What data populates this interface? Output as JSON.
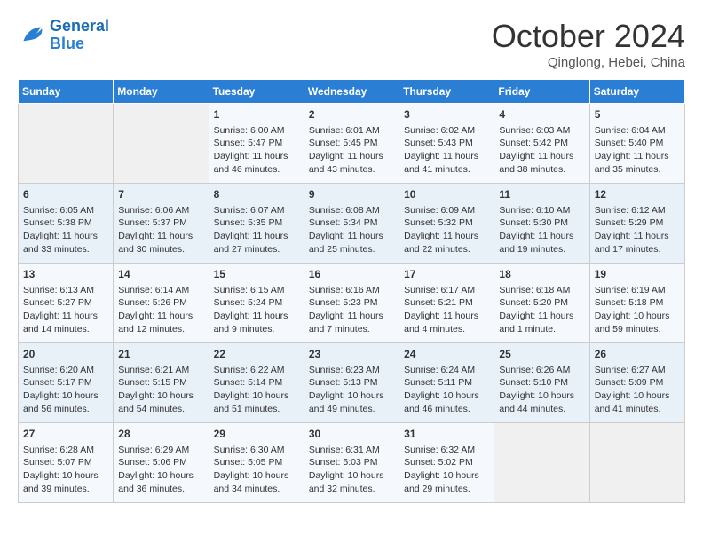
{
  "header": {
    "logo_line1": "General",
    "logo_line2": "Blue",
    "month": "October 2024",
    "location": "Qinglong, Hebei, China"
  },
  "days_of_week": [
    "Sunday",
    "Monday",
    "Tuesday",
    "Wednesday",
    "Thursday",
    "Friday",
    "Saturday"
  ],
  "weeks": [
    [
      {
        "day": "",
        "data": ""
      },
      {
        "day": "",
        "data": ""
      },
      {
        "day": "1",
        "data": "Sunrise: 6:00 AM\nSunset: 5:47 PM\nDaylight: 11 hours and 46 minutes."
      },
      {
        "day": "2",
        "data": "Sunrise: 6:01 AM\nSunset: 5:45 PM\nDaylight: 11 hours and 43 minutes."
      },
      {
        "day": "3",
        "data": "Sunrise: 6:02 AM\nSunset: 5:43 PM\nDaylight: 11 hours and 41 minutes."
      },
      {
        "day": "4",
        "data": "Sunrise: 6:03 AM\nSunset: 5:42 PM\nDaylight: 11 hours and 38 minutes."
      },
      {
        "day": "5",
        "data": "Sunrise: 6:04 AM\nSunset: 5:40 PM\nDaylight: 11 hours and 35 minutes."
      }
    ],
    [
      {
        "day": "6",
        "data": "Sunrise: 6:05 AM\nSunset: 5:38 PM\nDaylight: 11 hours and 33 minutes."
      },
      {
        "day": "7",
        "data": "Sunrise: 6:06 AM\nSunset: 5:37 PM\nDaylight: 11 hours and 30 minutes."
      },
      {
        "day": "8",
        "data": "Sunrise: 6:07 AM\nSunset: 5:35 PM\nDaylight: 11 hours and 27 minutes."
      },
      {
        "day": "9",
        "data": "Sunrise: 6:08 AM\nSunset: 5:34 PM\nDaylight: 11 hours and 25 minutes."
      },
      {
        "day": "10",
        "data": "Sunrise: 6:09 AM\nSunset: 5:32 PM\nDaylight: 11 hours and 22 minutes."
      },
      {
        "day": "11",
        "data": "Sunrise: 6:10 AM\nSunset: 5:30 PM\nDaylight: 11 hours and 19 minutes."
      },
      {
        "day": "12",
        "data": "Sunrise: 6:12 AM\nSunset: 5:29 PM\nDaylight: 11 hours and 17 minutes."
      }
    ],
    [
      {
        "day": "13",
        "data": "Sunrise: 6:13 AM\nSunset: 5:27 PM\nDaylight: 11 hours and 14 minutes."
      },
      {
        "day": "14",
        "data": "Sunrise: 6:14 AM\nSunset: 5:26 PM\nDaylight: 11 hours and 12 minutes."
      },
      {
        "day": "15",
        "data": "Sunrise: 6:15 AM\nSunset: 5:24 PM\nDaylight: 11 hours and 9 minutes."
      },
      {
        "day": "16",
        "data": "Sunrise: 6:16 AM\nSunset: 5:23 PM\nDaylight: 11 hours and 7 minutes."
      },
      {
        "day": "17",
        "data": "Sunrise: 6:17 AM\nSunset: 5:21 PM\nDaylight: 11 hours and 4 minutes."
      },
      {
        "day": "18",
        "data": "Sunrise: 6:18 AM\nSunset: 5:20 PM\nDaylight: 11 hours and 1 minute."
      },
      {
        "day": "19",
        "data": "Sunrise: 6:19 AM\nSunset: 5:18 PM\nDaylight: 10 hours and 59 minutes."
      }
    ],
    [
      {
        "day": "20",
        "data": "Sunrise: 6:20 AM\nSunset: 5:17 PM\nDaylight: 10 hours and 56 minutes."
      },
      {
        "day": "21",
        "data": "Sunrise: 6:21 AM\nSunset: 5:15 PM\nDaylight: 10 hours and 54 minutes."
      },
      {
        "day": "22",
        "data": "Sunrise: 6:22 AM\nSunset: 5:14 PM\nDaylight: 10 hours and 51 minutes."
      },
      {
        "day": "23",
        "data": "Sunrise: 6:23 AM\nSunset: 5:13 PM\nDaylight: 10 hours and 49 minutes."
      },
      {
        "day": "24",
        "data": "Sunrise: 6:24 AM\nSunset: 5:11 PM\nDaylight: 10 hours and 46 minutes."
      },
      {
        "day": "25",
        "data": "Sunrise: 6:26 AM\nSunset: 5:10 PM\nDaylight: 10 hours and 44 minutes."
      },
      {
        "day": "26",
        "data": "Sunrise: 6:27 AM\nSunset: 5:09 PM\nDaylight: 10 hours and 41 minutes."
      }
    ],
    [
      {
        "day": "27",
        "data": "Sunrise: 6:28 AM\nSunset: 5:07 PM\nDaylight: 10 hours and 39 minutes."
      },
      {
        "day": "28",
        "data": "Sunrise: 6:29 AM\nSunset: 5:06 PM\nDaylight: 10 hours and 36 minutes."
      },
      {
        "day": "29",
        "data": "Sunrise: 6:30 AM\nSunset: 5:05 PM\nDaylight: 10 hours and 34 minutes."
      },
      {
        "day": "30",
        "data": "Sunrise: 6:31 AM\nSunset: 5:03 PM\nDaylight: 10 hours and 32 minutes."
      },
      {
        "day": "31",
        "data": "Sunrise: 6:32 AM\nSunset: 5:02 PM\nDaylight: 10 hours and 29 minutes."
      },
      {
        "day": "",
        "data": ""
      },
      {
        "day": "",
        "data": ""
      }
    ]
  ]
}
